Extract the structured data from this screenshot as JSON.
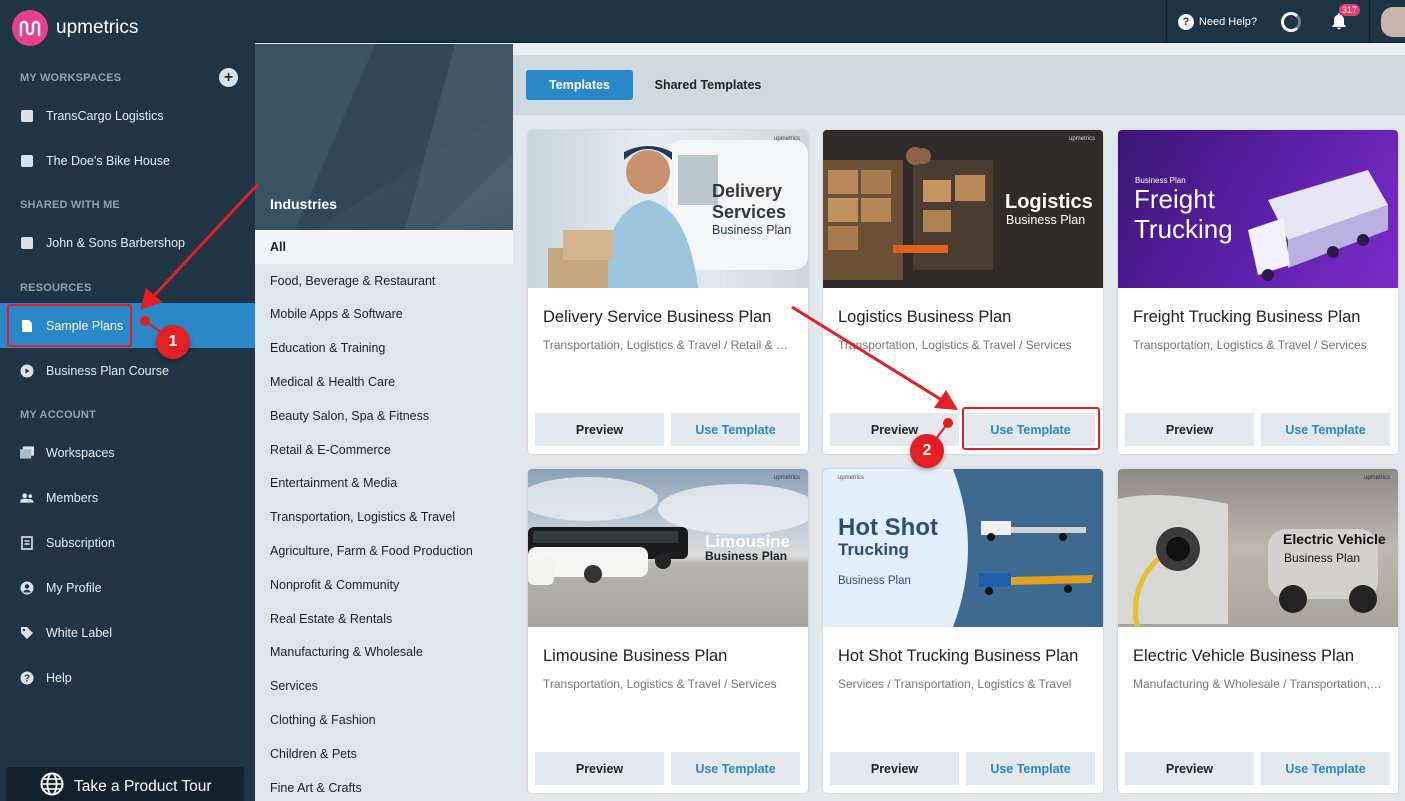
{
  "app": {
    "name": "upmetrics",
    "brand_color": "#e83e8c",
    "accent": "#2a87c8"
  },
  "topbar": {
    "help_label": "Need Help?",
    "notifications_count": "317"
  },
  "sidebar": {
    "sections": {
      "workspaces": "MY WORKSPACES",
      "shared": "SHARED WITH ME",
      "resources": "RESOURCES",
      "account": "MY ACCOUNT"
    },
    "workspaces": [
      "TransCargo Logistics",
      "The Doe's Bike House"
    ],
    "shared": [
      "John & Sons Barbershop"
    ],
    "resources": [
      "Sample Plans",
      "Business Plan Course"
    ],
    "account": [
      "Workspaces",
      "Members",
      "Subscription",
      "My Profile",
      "White Label",
      "Help"
    ],
    "tour_label": "Take a Product Tour"
  },
  "industries": {
    "title": "Industries",
    "items": [
      "All",
      "Food, Beverage & Restaurant",
      "Mobile Apps & Software",
      "Education & Training",
      "Medical & Health Care",
      "Beauty Salon, Spa & Fitness",
      "Retail & E-Commerce",
      "Entertainment & Media",
      "Transportation, Logistics & Travel",
      "Agriculture, Farm & Food Production",
      "Nonprofit & Community",
      "Real Estate & Rentals",
      "Manufacturing & Wholesale",
      "Services",
      "Clothing & Fashion",
      "Children & Pets",
      "Fine Art & Crafts"
    ]
  },
  "tabs": [
    "Templates",
    "Shared Templates"
  ],
  "buttons": {
    "preview": "Preview",
    "use": "Use Template"
  },
  "cards": [
    {
      "title": "Delivery Service Business Plan",
      "tags": "Transportation, Logistics & Travel / Retail & E-Commerce",
      "img_line1": "Delivery",
      "img_line2": "Services",
      "img_line3": "Business Plan"
    },
    {
      "title": "Logistics Business Plan",
      "tags": "Transportation, Logistics & Travel / Services",
      "img_line1": "Logistics",
      "img_line2": "Business Plan"
    },
    {
      "title": "Freight Trucking Business Plan",
      "tags": "Transportation, Logistics & Travel / Services",
      "img_small": "Business Plan",
      "img_line1": "Freight",
      "img_line2": "Trucking"
    },
    {
      "title": "Limousine Business Plan",
      "tags": "Transportation, Logistics & Travel / Services",
      "img_line1": "Limousine",
      "img_line2": "Business Plan"
    },
    {
      "title": "Hot Shot Trucking Business Plan",
      "tags": "Services / Transportation, Logistics & Travel",
      "img_line1": "Hot Shot",
      "img_line2": "Trucking",
      "img_line3": "Business Plan"
    },
    {
      "title": "Electric Vehicle Business Plan",
      "tags": "Manufacturing & Wholesale / Transportation, Logistics & Travel",
      "img_line1": "Electric Vehicle",
      "img_line2": "Business Plan"
    }
  ],
  "watermark": "upmetrics",
  "annotations": [
    "1",
    "2"
  ]
}
